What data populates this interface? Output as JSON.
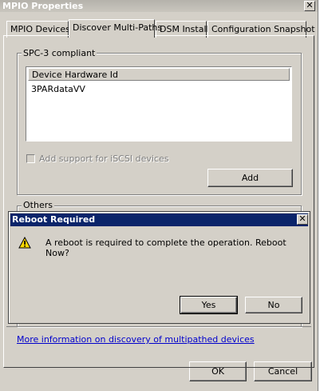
{
  "window": {
    "title": "MPIO Properties",
    "close_glyph": "✕"
  },
  "tabs": [
    {
      "label": "MPIO Devices"
    },
    {
      "label": "Discover Multi-Paths"
    },
    {
      "label": "DSM Install"
    },
    {
      "label": "Configuration Snapshot"
    }
  ],
  "spc3_group": {
    "label": "SPC-3 compliant",
    "column_header": "Device Hardware Id",
    "rows": [
      "3PARdataVV"
    ],
    "checkbox_label": "Add support for iSCSI devices",
    "checkbox_checked": false,
    "add_button": "Add"
  },
  "others_group": {
    "label": "Others"
  },
  "reboot_dialog": {
    "title": "Reboot Required",
    "close_glyph": "✕",
    "icon": "warning-icon",
    "message": "A reboot is required to complete the operation. Reboot Now?",
    "yes_button": "Yes",
    "no_button": "No"
  },
  "footer": {
    "link": "More information on discovery of multipathed devices",
    "ok_button": "OK",
    "cancel_button": "Cancel"
  },
  "colors": {
    "dialog_title_bar": "#0a246a",
    "face": "#d4d0c8",
    "link": "#0000cc"
  }
}
